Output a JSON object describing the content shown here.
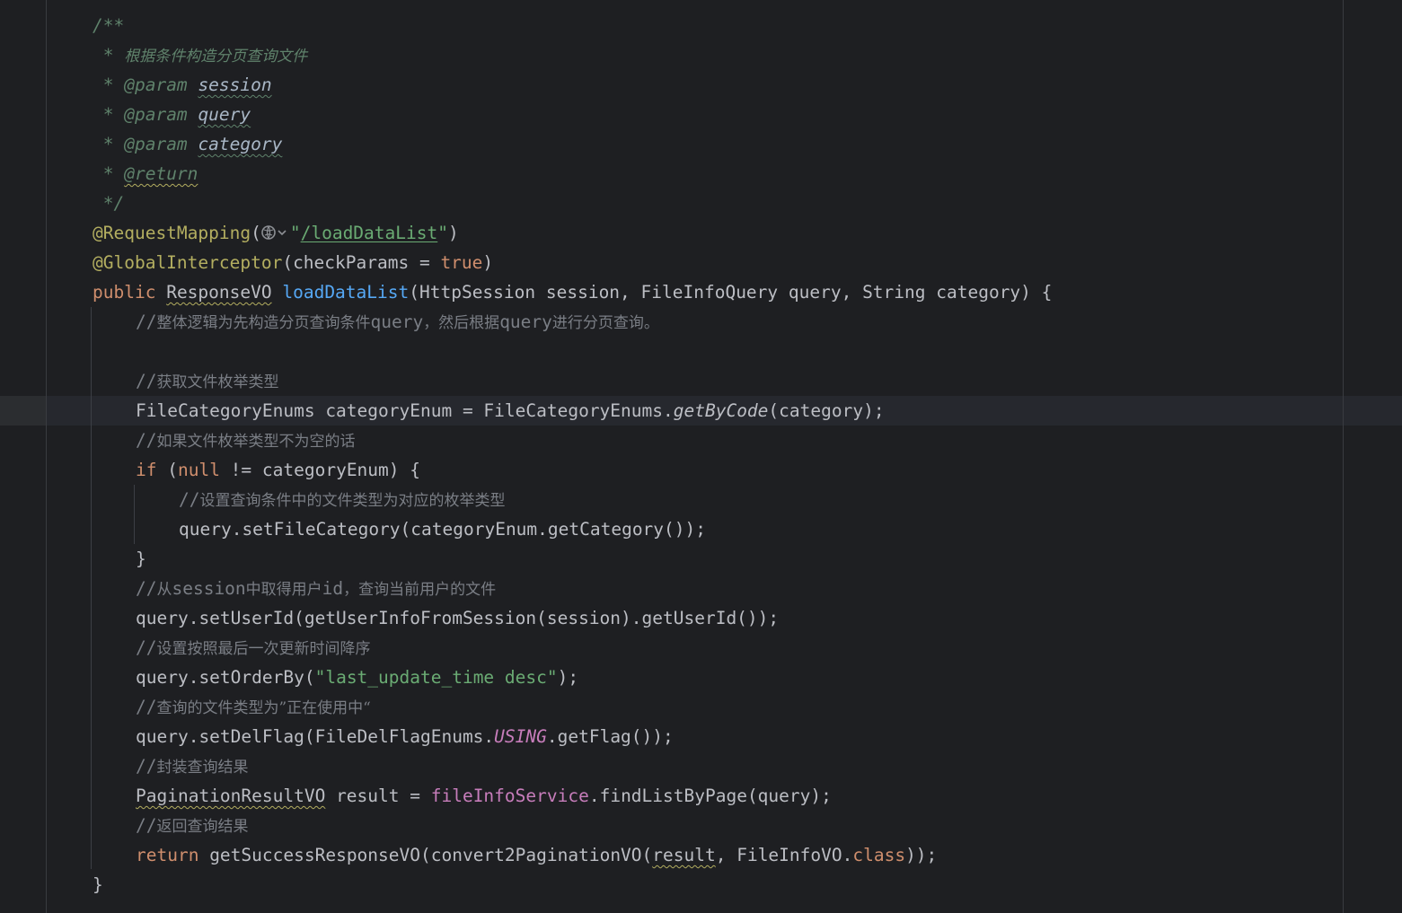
{
  "code": {
    "doc_open": "/**",
    "doc_desc_star": " * ",
    "doc_desc": "根据条件构造分页查询文件",
    "doc_params": [
      {
        "star": " * ",
        "tag": "@param",
        "name": "session"
      },
      {
        "star": " * ",
        "tag": "@param",
        "name": "query"
      },
      {
        "star": " * ",
        "tag": "@param",
        "name": "category"
      }
    ],
    "doc_return_star": " * ",
    "doc_return_tag": "@return",
    "doc_close": " */",
    "ann1_name": "@RequestMapping",
    "ann1_open": "(",
    "ann1_q1": "\"",
    "ann1_path": "/loadDataList",
    "ann1_q2": "\"",
    "ann1_close": ")",
    "ann2_name": "@GlobalInterceptor",
    "ann2_args_pre": "(checkParams = ",
    "ann2_true": "true",
    "ann2_close": ")",
    "sig_public": "public",
    "sig_type": "ResponseVO",
    "sig_name": "loadDataList",
    "sig_params": "(HttpSession session, FileInfoQuery query, String category) {",
    "c1_slash": "//",
    "c1_a": "整体逻辑为先构造分页查询条件",
    "c1_b": "query",
    "c1_c": "，然后根据",
    "c1_d": "query",
    "c1_e": "进行分页查询。",
    "c2_slash": "//",
    "c2_text": "获取文件枚举类型",
    "l_enum_a": "FileCategoryEnums categoryEnum = FileCategoryEnums.",
    "l_enum_b": "getByCode",
    "l_enum_c": "(category);",
    "c3_slash": "//",
    "c3_text": "如果文件枚举类型不为空的话",
    "if_kw": "if",
    "if_a": " (",
    "if_null": "null",
    "if_b": " != categoryEnum) {",
    "c4_slash": "//",
    "c4_text": "设置查询条件中的文件类型为对应的枚举类型",
    "l_setcat": "query.setFileCategory(categoryEnum.getCategory());",
    "close_if": "}",
    "c5_slash": "//",
    "c5_a": "从",
    "c5_b": "session",
    "c5_c": "中取得用户",
    "c5_d": "id",
    "c5_e": "，查询当前用户的文件",
    "l_setuser": "query.setUserId(getUserInfoFromSession(session).getUserId());",
    "c6_slash": "//",
    "c6_text": "设置按照最后一次更新时间降序",
    "l_order_a": "query.setOrderBy(",
    "l_order_str": "\"last_update_time desc\"",
    "l_order_b": ");",
    "c7_slash": "//",
    "c7_text": "查询的文件类型为”正在使用中“",
    "l_del_a": "query.setDelFlag(FileDelFlagEnums.",
    "l_del_b": "USING",
    "l_del_c": ".getFlag());",
    "c8_slash": "//",
    "c8_text": "封装查询结果",
    "l_res_type": "PaginationResultVO",
    "l_res_a": " result = ",
    "l_res_field": "fileInfoService",
    "l_res_b": ".findListByPage(query);",
    "c9_slash": "//",
    "c9_text": "返回查询结果",
    "ret_kw": "return",
    "ret_a": " getSuccessResponseVO(convert2PaginationVO(",
    "ret_result": "result",
    "ret_b": ", FileInfoVO.",
    "ret_class": "class",
    "ret_c": "));",
    "close_method": "}"
  },
  "icons": {
    "web_icon": "globe-with-chevron-icon"
  },
  "colors": {
    "background": "#1e1f22",
    "keyword": "#cf8e6d",
    "annotation": "#b3ae60",
    "string": "#6aab73",
    "method_decl": "#56a8f5",
    "field": "#c77dbb",
    "comment": "#7a7e85",
    "doc_comment": "#5f826b"
  }
}
